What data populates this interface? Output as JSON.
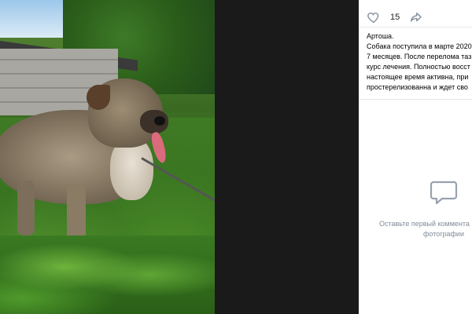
{
  "photo": {
    "alt_subject": "dog"
  },
  "actions": {
    "like_icon": "heart-icon",
    "like_count": "15",
    "share_icon": "share-arrow-icon"
  },
  "post": {
    "title": "Артоша.",
    "lines": [
      "Собака поступила в марте 2020",
      "7 месяцев. После перелома таз",
      "курс лечения. Полностью восст",
      "настоящее время активна, при",
      "простерелизованна и ждет сво"
    ]
  },
  "comments": {
    "icon": "comment-bubble-icon",
    "empty_line1": "Оставьте первый коммента",
    "empty_line2": "фотографии"
  },
  "colors": {
    "panel_bg": "#ffffff",
    "viewer_bg": "#1a1a1a",
    "muted_text": "#818c99",
    "icon_gray": "#99a2ad"
  }
}
